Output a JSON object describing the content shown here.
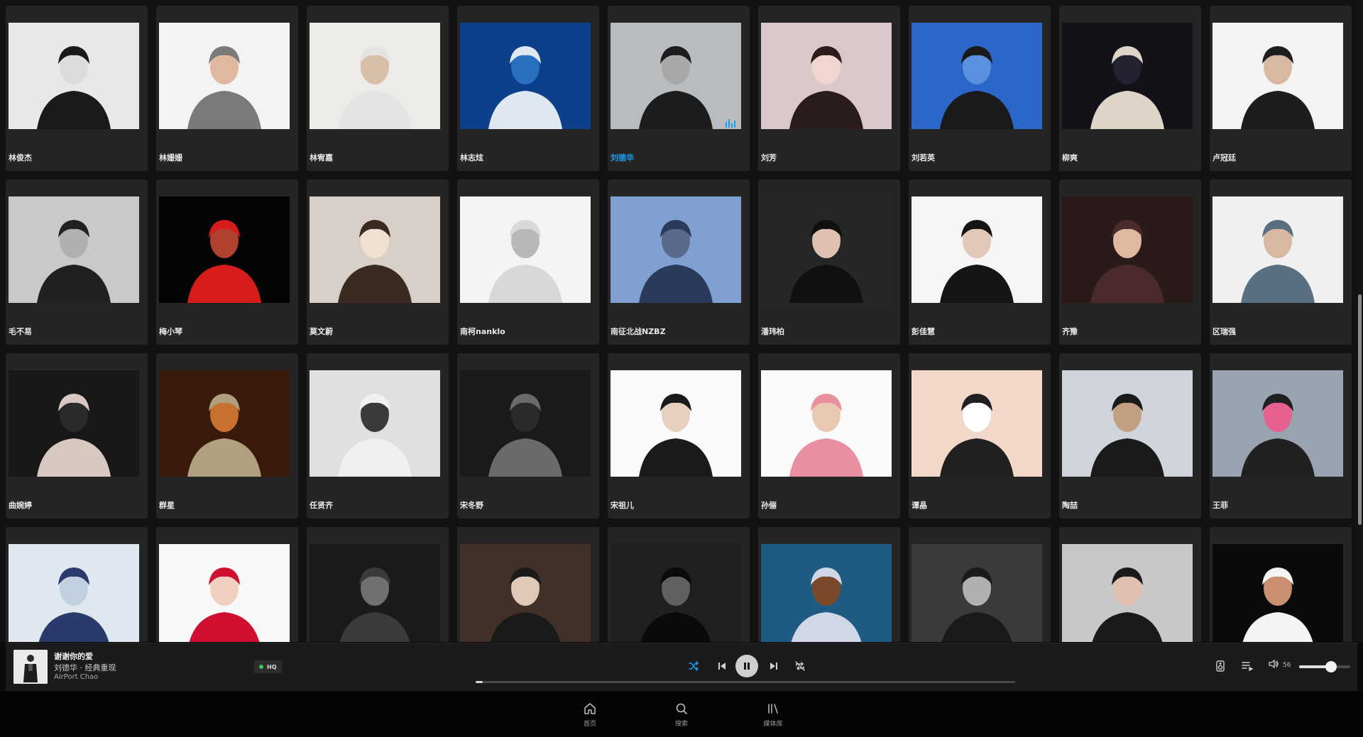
{
  "artists": [
    {
      "name": "林俊杰",
      "playing": false
    },
    {
      "name": "林姗姗",
      "playing": false
    },
    {
      "name": "林宥嘉",
      "playing": false
    },
    {
      "name": "林志炫",
      "playing": false
    },
    {
      "name": "刘德华",
      "playing": true
    },
    {
      "name": "刘芳",
      "playing": false
    },
    {
      "name": "刘若英",
      "playing": false
    },
    {
      "name": "柳爽",
      "playing": false
    },
    {
      "name": "卢冠廷",
      "playing": false
    },
    {
      "name": "毛不易",
      "playing": false
    },
    {
      "name": "梅小琴",
      "playing": false
    },
    {
      "name": "莫文蔚",
      "playing": false
    },
    {
      "name": "南柯nanklo",
      "playing": false
    },
    {
      "name": "南征北战NZBZ",
      "playing": false
    },
    {
      "name": "潘玮柏",
      "playing": false
    },
    {
      "name": "彭佳慧",
      "playing": false
    },
    {
      "name": "齐豫",
      "playing": false
    },
    {
      "name": "区瑞强",
      "playing": false
    },
    {
      "name": "曲婉婷",
      "playing": false
    },
    {
      "name": "群星",
      "playing": false
    },
    {
      "name": "任贤齐",
      "playing": false
    },
    {
      "name": "宋冬野",
      "playing": false
    },
    {
      "name": "宋祖儿",
      "playing": false
    },
    {
      "name": "孙俪",
      "playing": false
    },
    {
      "name": "谭晶",
      "playing": false
    },
    {
      "name": "陶喆",
      "playing": false
    },
    {
      "name": "王菲",
      "playing": false
    },
    {
      "name": "",
      "playing": false
    },
    {
      "name": "",
      "playing": false
    },
    {
      "name": "",
      "playing": false
    },
    {
      "name": "",
      "playing": false
    },
    {
      "name": "",
      "playing": false
    },
    {
      "name": "",
      "playing": false
    },
    {
      "name": "",
      "playing": false
    },
    {
      "name": "",
      "playing": false
    },
    {
      "name": "",
      "playing": false
    }
  ],
  "now_playing": {
    "title": "谢谢你的爱",
    "subtitle": "刘德华 · 经典重现",
    "device": "AirPort Chao",
    "quality_badge": "HQ",
    "progress_fraction": 0.013
  },
  "volume": {
    "value": "56",
    "level": 0.56
  },
  "nav": {
    "home": "首页",
    "search": "搜索",
    "library": "媒体库"
  },
  "colors": {
    "accent": "#1aa0f0",
    "hq_dot": "#38c55a"
  }
}
